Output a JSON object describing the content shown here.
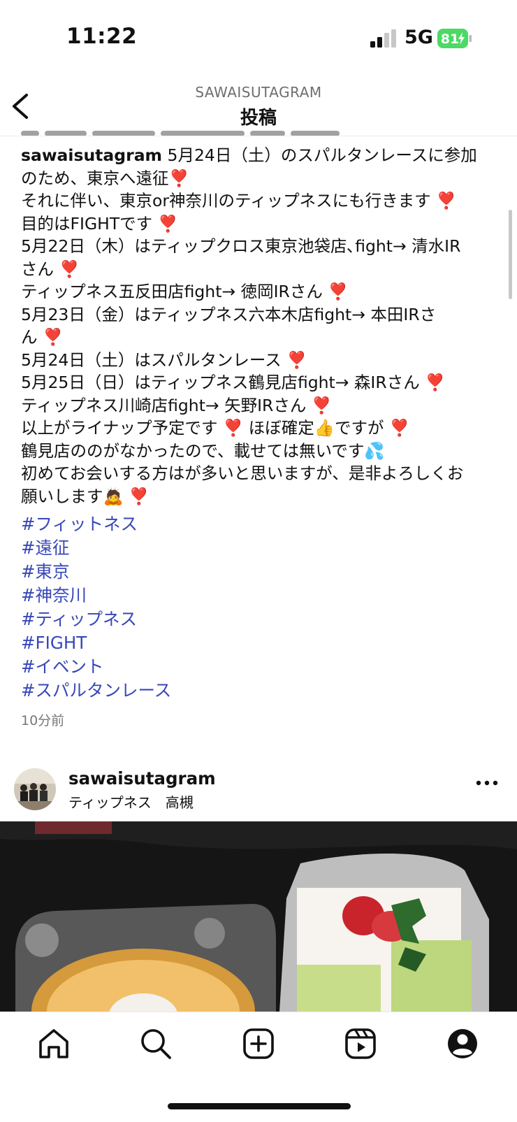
{
  "status_bar": {
    "time": "11:22",
    "network": "5G",
    "battery": "81"
  },
  "header": {
    "subtitle": "SAWAISUTAGRAM",
    "title": "投稿"
  },
  "caption": {
    "username": "sawaisutagram",
    "lines": [
      "5月24日（土）のスパルタンレースに参加",
      "のため、東京へ遠征",
      "それに伴い、東京or神奈川のティップネスにも行きます",
      "目的はFIGHTです",
      "5月22日（木）はティップクロス東京池袋店､fight→ 清水IR",
      "さん",
      "ティップネス五反田店fight→ 徳岡IRさん",
      "5月23日（金）はティップネス六本木店fight→ 本田IRさ",
      "ん",
      "5月24日（土）はスパルタンレース",
      "5月25日（日）はティップネス鶴見店fight→ 森IRさん",
      "ティップネス川崎店fight→ 矢野IRさん",
      "以上がライナップ予定です",
      "ほぼ確定",
      "ですが",
      "鶴見店ののがなかったので、載せては無いです",
      "初めてお会いする方はが多いと思いますが、是非よろしくお",
      "願いします"
    ]
  },
  "hashtags": [
    "#フィットネス",
    "#遠征",
    "#東京",
    "#神奈川",
    "#ティップネス",
    "#FIGHT",
    "#イベント",
    "#スパルタンレース"
  ],
  "time_ago": "10分前",
  "next_post": {
    "username": "sawaisutagram",
    "location": "ティップネス　高槻"
  },
  "icons": {
    "heart": "heavy-heart-exclamation",
    "thumb": "thumbs-up",
    "sweat": "sweat-droplets",
    "bow": "person-bowing",
    "tabs": [
      "home-icon",
      "search-icon",
      "create-icon",
      "reels-icon",
      "profile-icon"
    ]
  },
  "colors": {
    "hashtag": "#3747b8",
    "heart": "#e0232f",
    "battery": "#4cd964"
  }
}
